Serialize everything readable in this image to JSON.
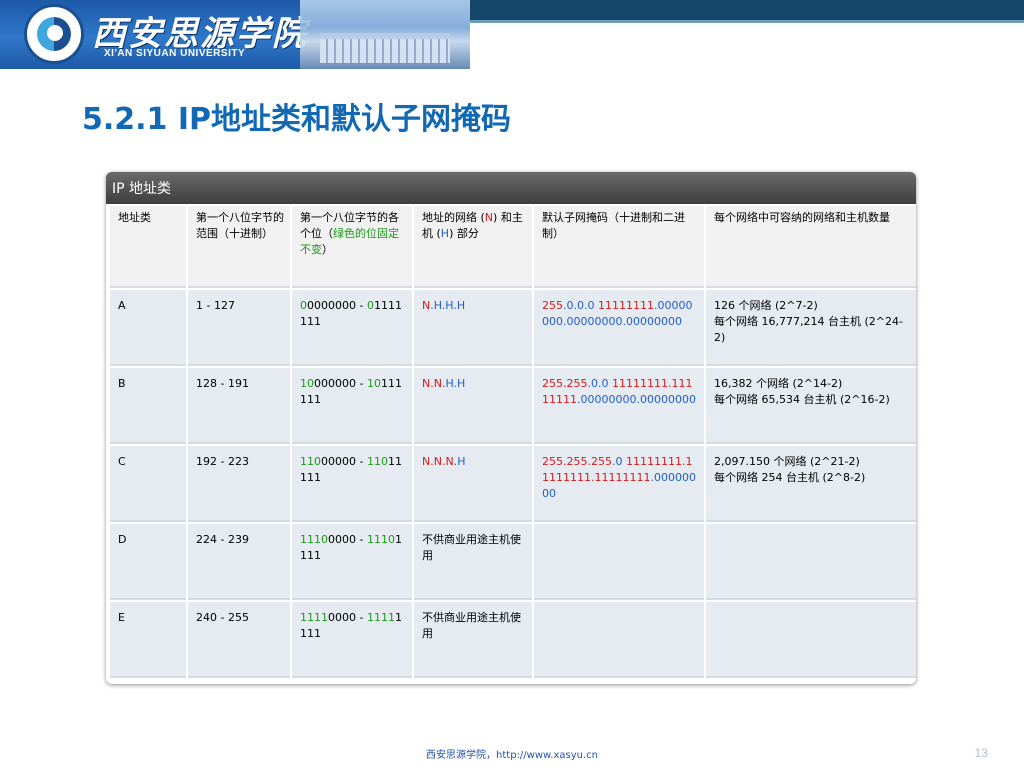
{
  "header": {
    "school_cn": "西安思源学院",
    "school_en": "XI'AN SIYUAN UNIVERSITY"
  },
  "slide": {
    "title": "5.2.1 IP地址类和默认子网掩码",
    "page_number": "13"
  },
  "footer": {
    "text": "西安思源学院，http://www.xasyu.cn"
  },
  "table": {
    "title": "IP 地址类",
    "headers": [
      {
        "parts": [
          {
            "t": "地址类",
            "c": ""
          }
        ]
      },
      {
        "parts": [
          {
            "t": "第一个八位字节的范围（十进制）",
            "c": ""
          }
        ]
      },
      {
        "parts": [
          {
            "t": "第一个八位字节的各个位（",
            "c": ""
          },
          {
            "t": "绿色的位固定不变",
            "c": "g"
          },
          {
            "t": "）",
            "c": ""
          }
        ]
      },
      {
        "parts": [
          {
            "t": "地址的网络 (",
            "c": ""
          },
          {
            "t": "N",
            "c": "r"
          },
          {
            "t": ") 和主机 (",
            "c": ""
          },
          {
            "t": "H",
            "c": "b"
          },
          {
            "t": ") 部分",
            "c": ""
          }
        ]
      },
      {
        "parts": [
          {
            "t": "默认子网掩码（十进制和二进制）",
            "c": ""
          }
        ]
      },
      {
        "parts": [
          {
            "t": "每个网络中可容纳的网络和主机数量",
            "c": ""
          }
        ]
      }
    ],
    "rows": [
      [
        {
          "parts": [
            {
              "t": "A",
              "c": ""
            }
          ]
        },
        {
          "parts": [
            {
              "t": "1 - 127",
              "c": ""
            }
          ]
        },
        {
          "parts": [
            {
              "t": "0",
              "c": "g"
            },
            {
              "t": "0000000 - ",
              "c": ""
            },
            {
              "t": "0",
              "c": "g"
            },
            {
              "t": "1111111",
              "c": ""
            }
          ]
        },
        {
          "parts": [
            {
              "t": "N",
              "c": "r"
            },
            {
              "t": ".H.H.H",
              "c": "b"
            }
          ]
        },
        {
          "parts": [
            {
              "t": "255",
              "c": "r"
            },
            {
              "t": ".0.0.0 ",
              "c": "b"
            },
            {
              "t": "11111111",
              "c": "r"
            },
            {
              "t": ".00000000.00000000.00000000",
              "c": "b"
            }
          ]
        },
        {
          "parts": [
            {
              "t": "126 个网络 (2^7-2)",
              "c": ""
            },
            {
              "t": "\n每个网络 16,777,214 台主机 (2^24-2)",
              "c": ""
            }
          ]
        }
      ],
      [
        {
          "parts": [
            {
              "t": "B",
              "c": ""
            }
          ]
        },
        {
          "parts": [
            {
              "t": "128 - 191",
              "c": ""
            }
          ]
        },
        {
          "parts": [
            {
              "t": "10",
              "c": "g"
            },
            {
              "t": "000000 - ",
              "c": ""
            },
            {
              "t": "10",
              "c": "g"
            },
            {
              "t": "111111",
              "c": ""
            }
          ]
        },
        {
          "parts": [
            {
              "t": "N.N.",
              "c": "r"
            },
            {
              "t": "H.H",
              "c": "b"
            }
          ]
        },
        {
          "parts": [
            {
              "t": "255.255",
              "c": "r"
            },
            {
              "t": ".0.0 ",
              "c": "b"
            },
            {
              "t": "11111111.11111111",
              "c": "r"
            },
            {
              "t": ".00000000.00000000",
              "c": "b"
            }
          ]
        },
        {
          "parts": [
            {
              "t": "16,382 个网络 (2^14-2)",
              "c": ""
            },
            {
              "t": "\n每个网络 65,534 台主机 (2^16-2)",
              "c": ""
            }
          ]
        }
      ],
      [
        {
          "parts": [
            {
              "t": "C",
              "c": ""
            }
          ]
        },
        {
          "parts": [
            {
              "t": "192 - 223",
              "c": ""
            }
          ]
        },
        {
          "parts": [
            {
              "t": "110",
              "c": "g"
            },
            {
              "t": "00000 - ",
              "c": ""
            },
            {
              "t": "110",
              "c": "g"
            },
            {
              "t": "11111",
              "c": ""
            }
          ]
        },
        {
          "parts": [
            {
              "t": "N.N.N.",
              "c": "r"
            },
            {
              "t": "H",
              "c": "b"
            }
          ]
        },
        {
          "parts": [
            {
              "t": "255.255.255",
              "c": "r"
            },
            {
              "t": ".0 ",
              "c": "b"
            },
            {
              "t": "11111111.11111111.11111111",
              "c": "r"
            },
            {
              "t": ".00000000",
              "c": "b"
            }
          ]
        },
        {
          "parts": [
            {
              "t": "2,097.150 个网络 (2^21-2)",
              "c": ""
            },
            {
              "t": "\n每个网络 254 台主机 (2^8-2)",
              "c": ""
            }
          ]
        }
      ],
      [
        {
          "parts": [
            {
              "t": "D",
              "c": ""
            }
          ]
        },
        {
          "parts": [
            {
              "t": "224 - 239",
              "c": ""
            }
          ]
        },
        {
          "parts": [
            {
              "t": "1110",
              "c": "g"
            },
            {
              "t": "0000 - ",
              "c": ""
            },
            {
              "t": "1110",
              "c": "g"
            },
            {
              "t": "1111",
              "c": ""
            }
          ]
        },
        {
          "parts": [
            {
              "t": "不供商业用途主机使用",
              "c": ""
            }
          ]
        },
        {
          "parts": []
        },
        {
          "parts": []
        }
      ],
      [
        {
          "parts": [
            {
              "t": "E",
              "c": ""
            }
          ]
        },
        {
          "parts": [
            {
              "t": "240 - 255",
              "c": ""
            }
          ]
        },
        {
          "parts": [
            {
              "t": "1111",
              "c": "g"
            },
            {
              "t": "0000 - ",
              "c": ""
            },
            {
              "t": "1111",
              "c": "g"
            },
            {
              "t": "1111",
              "c": ""
            }
          ]
        },
        {
          "parts": [
            {
              "t": "不供商业用途主机使用",
              "c": ""
            }
          ]
        },
        {
          "parts": []
        },
        {
          "parts": []
        }
      ]
    ]
  }
}
